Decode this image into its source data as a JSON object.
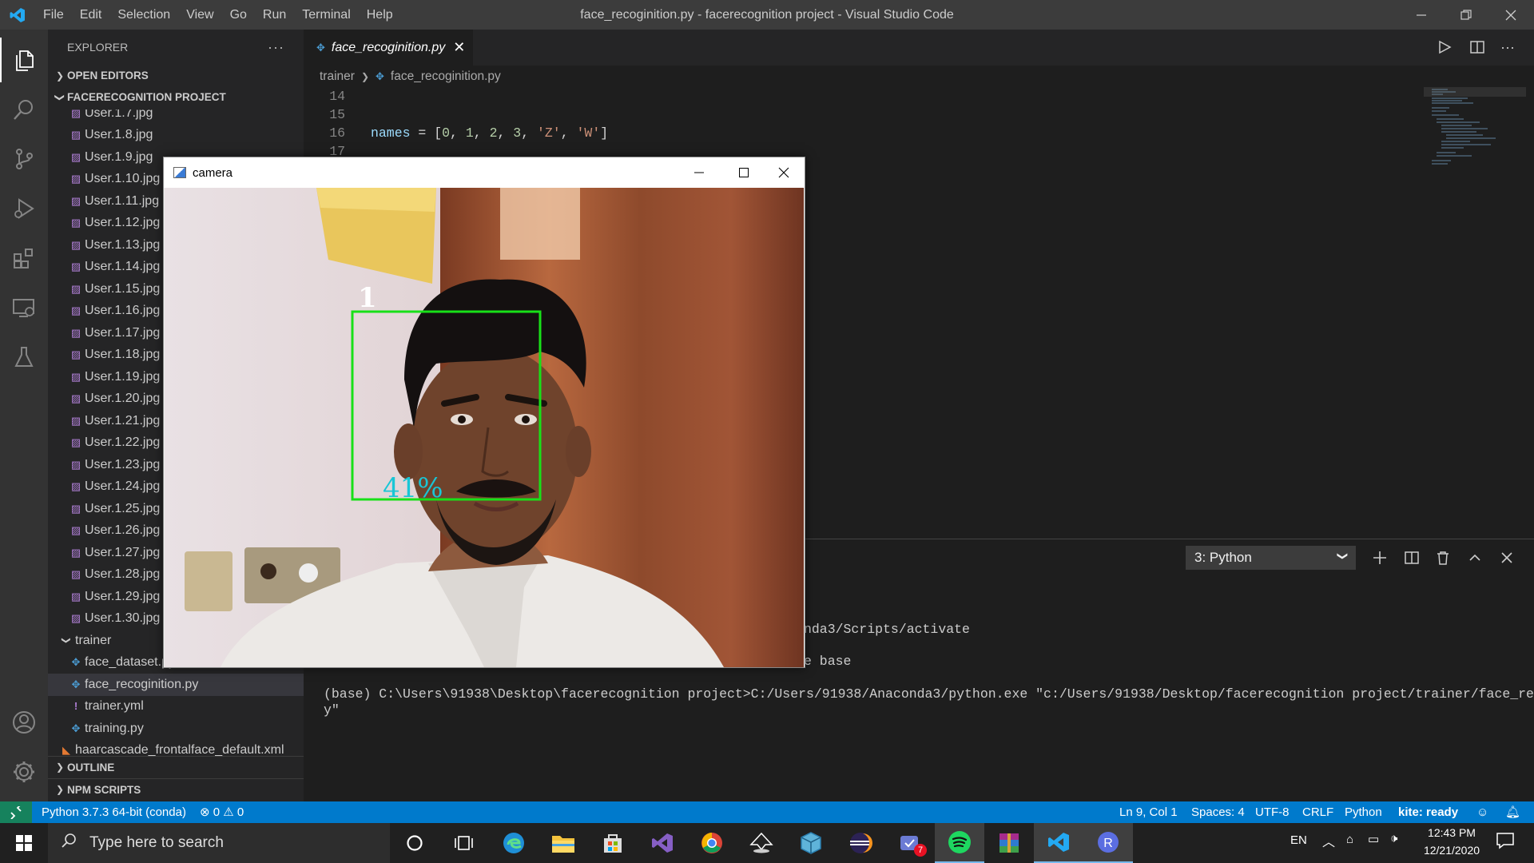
{
  "window": {
    "title": "face_recoginition.py - facerecognition project - Visual Studio Code",
    "menu": [
      "File",
      "Edit",
      "Selection",
      "View",
      "Go",
      "Run",
      "Terminal",
      "Help"
    ]
  },
  "sidebar": {
    "header": "EXPLORER",
    "open_editors": "OPEN EDITORS",
    "project": "FACERECOGNITION PROJECT",
    "files": [
      "User.1.7.jpg",
      "User.1.8.jpg",
      "User.1.9.jpg",
      "User.1.10.jpg",
      "User.1.11.jpg",
      "User.1.12.jpg",
      "User.1.13.jpg",
      "User.1.14.jpg",
      "User.1.15.jpg",
      "User.1.16.jpg",
      "User.1.17.jpg",
      "User.1.18.jpg",
      "User.1.19.jpg",
      "User.1.20.jpg",
      "User.1.21.jpg",
      "User.1.22.jpg",
      "User.1.23.jpg",
      "User.1.24.jpg",
      "User.1.25.jpg",
      "User.1.26.jpg",
      "User.1.27.jpg",
      "User.1.28.jpg",
      "User.1.29.jpg",
      "User.1.30.jpg"
    ],
    "trainer_folder": "trainer",
    "trainer_files": [
      "face_dataset.py",
      "face_recoginition.py",
      "trainer.yml",
      "training.py"
    ],
    "xml_file": "haarcascade_frontalface_default.xml",
    "outline": "OUTLINE",
    "npm": "NPM SCRIPTS"
  },
  "editor": {
    "tab": "face_recoginition.py",
    "breadcrumb": [
      "trainer",
      "face_recoginition.py"
    ],
    "lines": [
      {
        "n": "14",
        "code": ""
      },
      {
        "n": "15",
        "code": ""
      },
      {
        "n": "16",
        "code": "names = [0, 1, 2, 3, 'Z', 'W']"
      },
      {
        "n": "17",
        "code": ""
      }
    ]
  },
  "panel": {
    "terminal_select": "3: Python",
    "lines": [
      "nda3/Scripts/activate",
      "e base",
      "(base) C:\\Users\\91938\\Desktop\\facerecognition project>C:/Users/91938/Anaconda3/python.exe \"c:/Users/91938/Desktop/facerecognition project/trainer/face_recoginition.p",
      "y\""
    ]
  },
  "statusbar": {
    "interpreter": "Python 3.7.3 64-bit (conda)",
    "errors": "0",
    "warnings": "0",
    "position": "Ln 9, Col 1",
    "spaces": "Spaces: 4",
    "encoding": "UTF-8",
    "eol": "CRLF",
    "language": "Python",
    "kite": "kite: ready"
  },
  "camera": {
    "title": "camera",
    "face_id": "1",
    "confidence": "41%"
  },
  "taskbar": {
    "search_placeholder": "Type here to search",
    "lang": "EN",
    "time": "12:43 PM",
    "date": "12/21/2020",
    "notification_count": "7"
  },
  "colors": {
    "accent": "#007acc",
    "face_box": "#18e018",
    "confidence_text": "#19c6d6"
  }
}
